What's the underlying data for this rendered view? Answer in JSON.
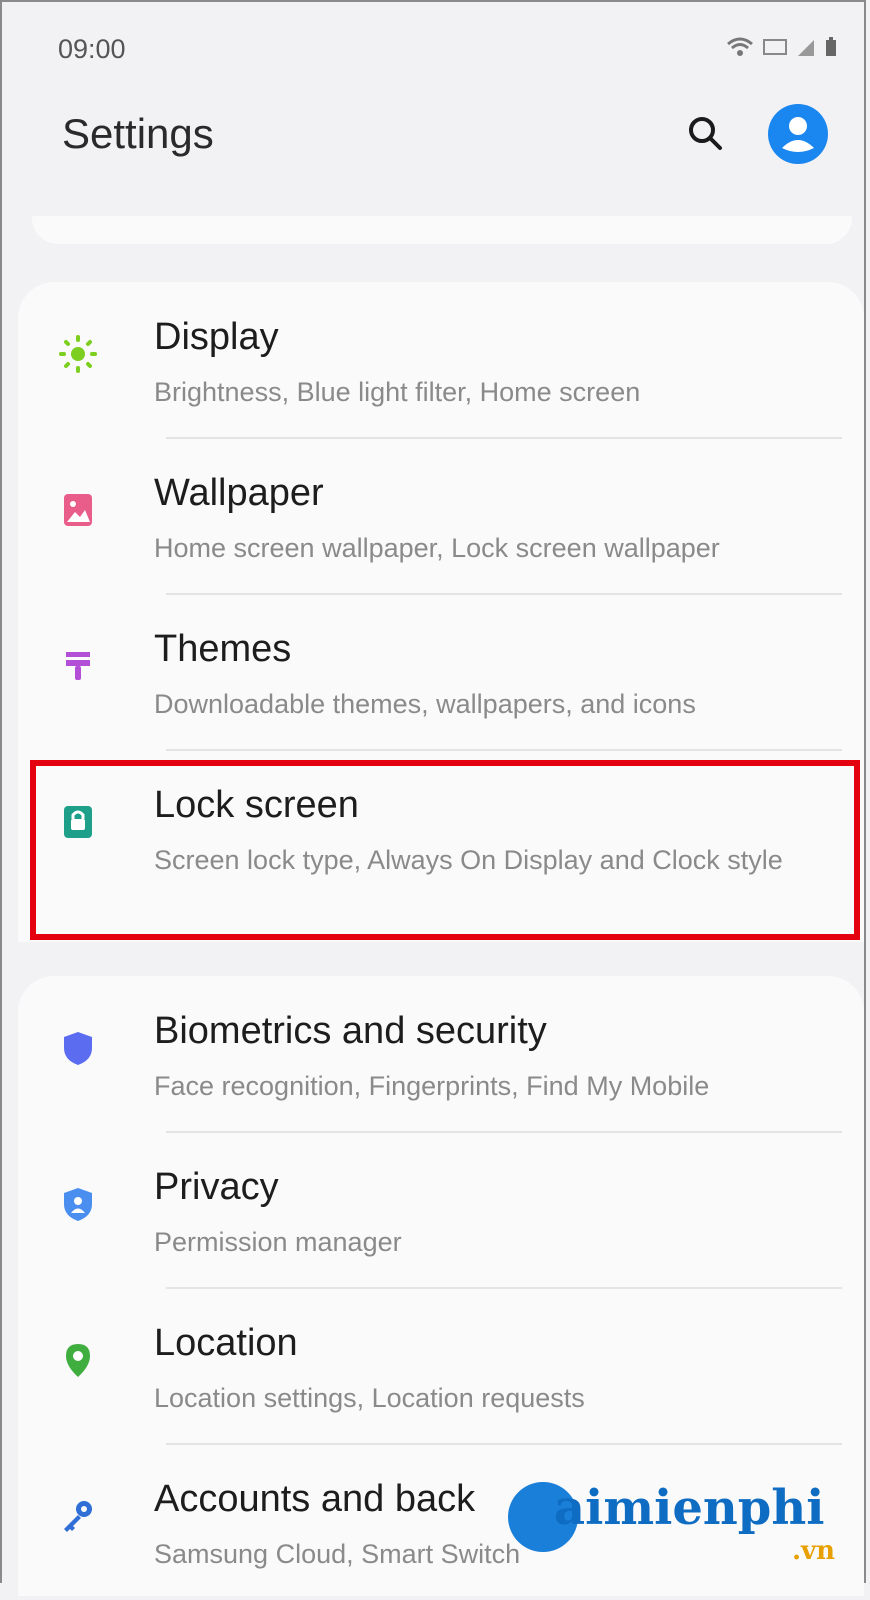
{
  "status_bar": {
    "time": "09:00"
  },
  "header": {
    "title": "Settings"
  },
  "groups": [
    {
      "items": [
        {
          "title": "Display",
          "subtitle": "Brightness, Blue light filter, Home screen",
          "icon": "brightness-icon",
          "icon_color": "#7ccf1e"
        },
        {
          "title": "Wallpaper",
          "subtitle": "Home screen wallpaper, Lock screen wallpaper",
          "icon": "wallpaper-icon",
          "icon_color": "#e85d8a"
        },
        {
          "title": "Themes",
          "subtitle": "Downloadable themes, wallpapers, and icons",
          "icon": "themes-brush-icon",
          "icon_color": "#b24fd6"
        },
        {
          "title": "Lock screen",
          "subtitle": "Screen lock type, Always On Display and Clock style",
          "icon": "lock-screen-icon",
          "icon_color": "#1d9f8a",
          "highlighted": true
        }
      ]
    },
    {
      "items": [
        {
          "title": "Biometrics and security",
          "subtitle": "Face recognition, Fingerprints, Find My Mobile",
          "icon": "shield-icon",
          "icon_color": "#5b6cf0"
        },
        {
          "title": "Privacy",
          "subtitle": "Permission manager",
          "icon": "privacy-shield-icon",
          "icon_color": "#4a8ef0"
        },
        {
          "title": "Location",
          "subtitle": "Location settings, Location requests",
          "icon": "location-pin-icon",
          "icon_color": "#3fae3f"
        },
        {
          "title": "Accounts and back",
          "subtitle": "Samsung Cloud, Smart Switch",
          "icon": "key-icon",
          "icon_color": "#2f6fd6"
        }
      ]
    }
  ],
  "watermark": {
    "text": "aimienphi",
    "suffix": ".vn"
  },
  "colors": {
    "accent": "#1a86ef",
    "highlight_border": "#e3000f"
  }
}
